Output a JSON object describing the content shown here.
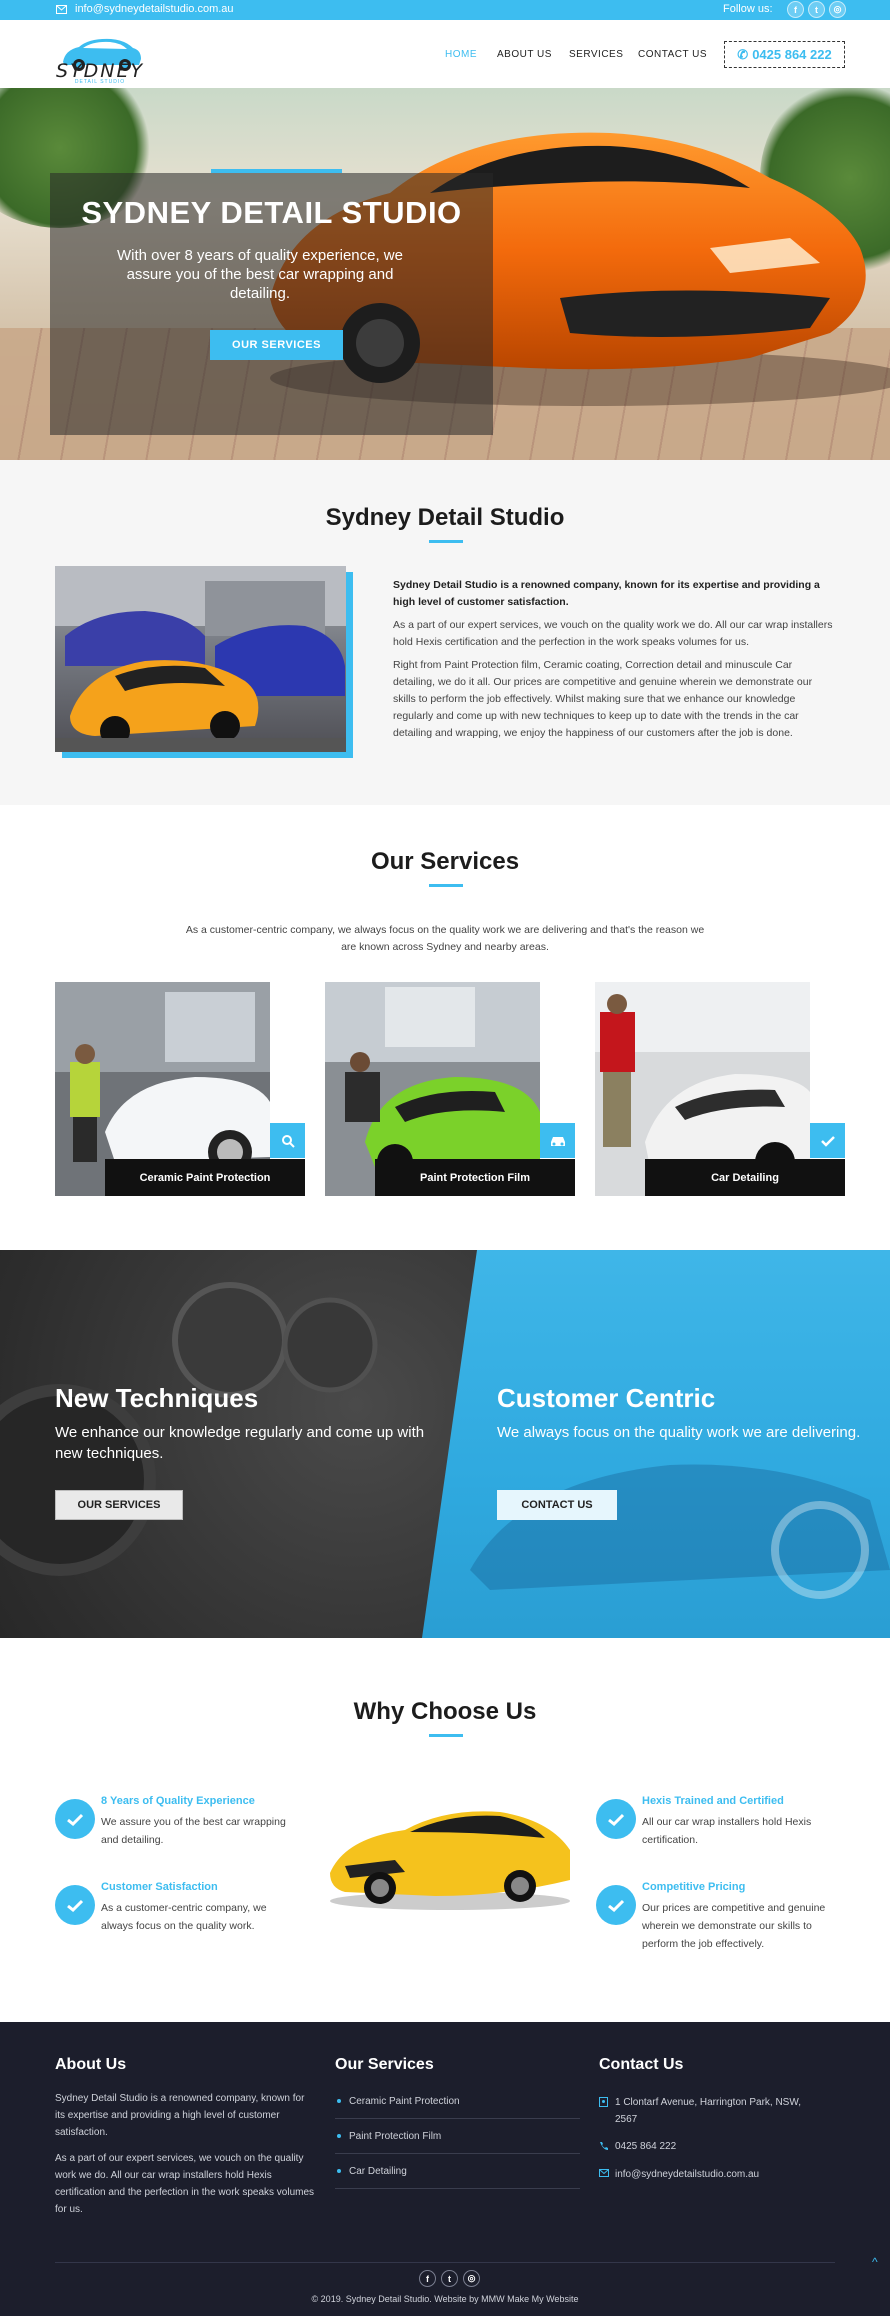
{
  "topbar": {
    "email": "info@sydneydetailstudio.com.au",
    "follow_label": "Follow us:",
    "social": [
      {
        "icon": "facebook-icon",
        "glyph": "f"
      },
      {
        "icon": "twitter-icon",
        "glyph": "t"
      },
      {
        "icon": "instagram-icon",
        "glyph": "◎"
      }
    ]
  },
  "header": {
    "logo_text": "SYDNEY",
    "logo_sub": "DETAIL STUDIO",
    "nav": [
      "HOME",
      "ABOUT US",
      "SERVICES",
      "CONTACT US"
    ],
    "phone": "0425 864 222"
  },
  "hero": {
    "title": "SYDNEY DETAIL STUDIO",
    "subtitle": "With over 8 years of quality experience, we assure you of the best car wrapping and detailing.",
    "button": "OUR SERVICES"
  },
  "about": {
    "title": "Sydney Detail Studio",
    "lead": "Sydney Detail Studio is a renowned company, known for its expertise and providing a high level of customer satisfaction.",
    "p1": "As a part of our expert services, we vouch on the quality work we do. All our car wrap installers hold Hexis certification and the perfection in the work speaks volumes for us.",
    "p2": "Right from Paint Protection film, Ceramic coating, Correction detail and minuscule Car detailing, we do it all. Our prices are competitive and genuine wherein we demonstrate our skills to perform the job effectively. Whilst making sure that we enhance our knowledge regularly and come up with new techniques to keep up to date with the trends in the car detailing and wrapping, we enjoy the happiness of our customers after the job is done."
  },
  "services": {
    "title": "Our Services",
    "intro": "As a customer-centric company, we always focus on the quality work we are delivering and that's the reason we are known across Sydney and nearby areas.",
    "cards": [
      {
        "label": "Ceramic Paint Protection",
        "icon": "search-icon",
        "car_color": "#ffffff"
      },
      {
        "label": "Paint Protection Film",
        "icon": "car-icon",
        "car_color": "#7bd12a"
      },
      {
        "label": "Car Detailing",
        "icon": "check-icon",
        "car_color": "#f2f2f2"
      }
    ]
  },
  "split": {
    "left_title": "New Techniques",
    "left_text": "We enhance our knowledge regularly and come up with new techniques.",
    "left_button": "OUR SERVICES",
    "right_title": "Customer Centric",
    "right_text": "We always focus on the quality work we are delivering.",
    "right_button": "CONTACT US"
  },
  "why": {
    "title": "Why Choose Us",
    "features": [
      {
        "title": "8 Years of Quality Experience",
        "text": "We assure you of the best car wrapping and detailing."
      },
      {
        "title": "Customer Satisfaction",
        "text": "As a customer-centric company, we always focus on the quality work."
      },
      {
        "title": "Hexis Trained and Certified",
        "text": "All our car wrap installers hold Hexis certification."
      },
      {
        "title": "Competitive Pricing",
        "text": "Our prices are competitive and genuine wherein we demonstrate our skills to perform the job effectively."
      }
    ]
  },
  "footer": {
    "about_title": "About Us",
    "about_p1": "Sydney Detail Studio is a renowned company, known for its expertise and providing a high level of customer satisfaction.",
    "about_p2": "As a part of our expert services, we vouch on the quality work we do. All our car wrap installers hold Hexis certification and the perfection in the work speaks volumes for us.",
    "services_title": "Our Services",
    "services": [
      "Ceramic Paint Protection",
      "Paint Protection Film",
      "Car Detailing"
    ],
    "contact_title": "Contact Us",
    "address": "1 Clontarf Avenue, Harrington Park, NSW, 2567",
    "phone": "0425 864 222",
    "email": "info@sydneydetailstudio.com.au",
    "copyright": "© 2019. Sydney Detail Studio. Website by MMW Make My Website"
  },
  "colors": {
    "accent": "#3dbdf0",
    "footer_bg": "#1c1e2c"
  }
}
